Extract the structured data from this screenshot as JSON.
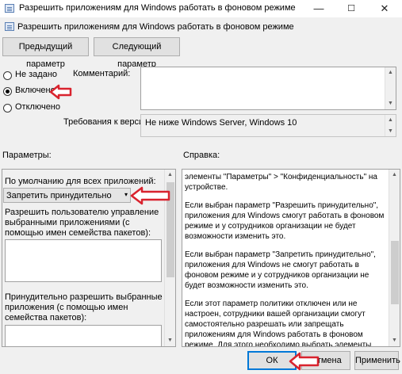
{
  "window": {
    "title": "Разрешить приложениям для Windows работать в фоновом режиме",
    "minimize": "—",
    "maximize": "☐",
    "close": "✕"
  },
  "policy_title": "Разрешить приложениям для Windows работать в фоновом режиме",
  "toolbar": {
    "prev_label": "Предыдущий параметр",
    "next_label": "Следующий параметр"
  },
  "state": {
    "not_configured": "Не задано",
    "enabled": "Включено",
    "disabled": "Отключено",
    "selected": "enabled"
  },
  "comment_label": "Комментарий:",
  "comment_value": "",
  "supported_label": "Требования к версии:",
  "supported_value": "Не ниже Windows Server, Windows 10",
  "options_label": "Параметры:",
  "help_label": "Справка:",
  "options": {
    "default_label": "По умолчанию для всех приложений:",
    "default_value": "Запретить принудительно",
    "user_control_label": "Разрешить пользователю управление выбранными приложениями (с помощью имен семейства пакетов):",
    "force_allow_label": "Принудительно разрешить выбранные приложения (с помощью имен семейства пакетов):"
  },
  "help": {
    "p1": "элементы \"Параметры\" > \"Конфиденциальность\" на устройстве.",
    "p2": "Если выбран параметр \"Разрешить принудительно\", приложения для Windows смогут работать в фоновом режиме и у сотрудников организации не будет возможности изменить это.",
    "p3": "Если выбран параметр \"Запретить принудительно\", приложения для Windows не смогут работать в фоновом режиме и у сотрудников организации не будет возможности изменить это.",
    "p4": "Если этот параметр политики отключен или не настроен, сотрудники вашей организации смогут самостоятельно разрешать или запрещать приложениям для Windows работать в фоновом режиме. Для этого необходимо выбрать элементы \"Параметры\" > \"Конфиденциальность\" на устройстве."
  },
  "buttons": {
    "ok": "ОК",
    "cancel": "Отмена",
    "apply": "Применить"
  },
  "colors": {
    "annotation_arrow": "#d9232e",
    "focus": "#0078d7"
  }
}
